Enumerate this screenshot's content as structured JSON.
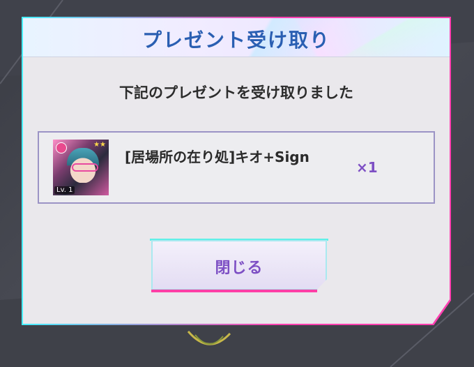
{
  "dialog": {
    "title": "プレゼント受け取り",
    "message": "下記のプレゼントを受け取りました",
    "item": {
      "name": "[居場所の在り処]キオ+Sign",
      "quantity": "×1",
      "level": "Lv. 1",
      "icon": "character-card-icon"
    },
    "close_label": "閉じる"
  },
  "colors": {
    "title": "#2a5fb2",
    "accent_purple": "#7d4fc4",
    "border_pink": "#ff3fa6",
    "border_cyan": "#5ef0e8"
  }
}
